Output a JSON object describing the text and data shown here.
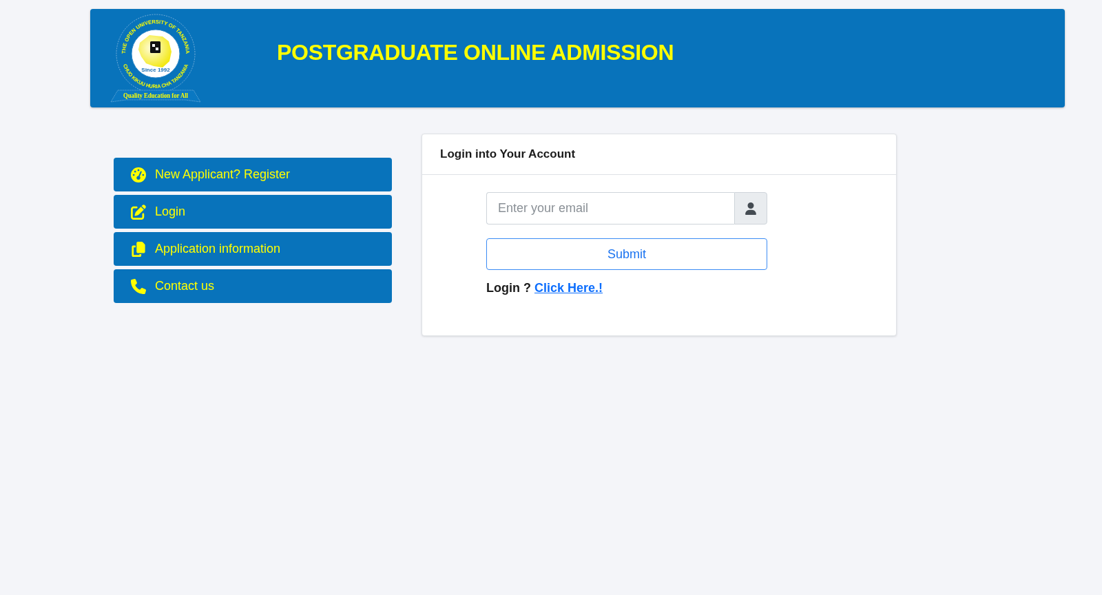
{
  "header": {
    "logo": {
      "ring_top": "THE OPEN UNIVERSITY OF TANZANIA",
      "ring_bottom": "CHUO KIKUU HURIA CHA TANZANIA",
      "since": "Since 1992",
      "motto": "Quality Education for All"
    },
    "title": "POSTGRADUATE ONLINE ADMISSION"
  },
  "sidebar": {
    "items": [
      {
        "kind": "register",
        "label": "New Applicant? Register"
      },
      {
        "kind": "login",
        "label": "Login"
      },
      {
        "kind": "info",
        "label": "Application information"
      },
      {
        "kind": "contact",
        "label": "Contact us"
      }
    ]
  },
  "login_card": {
    "title": "Login into Your Account",
    "email_field": {
      "placeholder": "Enter your email"
    },
    "submit": "Submit",
    "login_prompt": {
      "text": "Login ?",
      "link": "Click Here.!"
    }
  }
}
